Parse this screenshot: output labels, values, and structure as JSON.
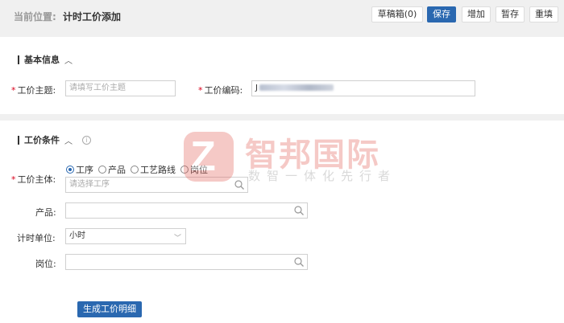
{
  "breadcrumb": {
    "label": "当前位置:",
    "current": "计时工价添加"
  },
  "toolbar": {
    "drafts": "草稿箱(0)",
    "save": "保存",
    "add": "增加",
    "temp_save": "暂存",
    "reset": "重填"
  },
  "basic": {
    "title": "基本信息",
    "topic_label": "工价主题:",
    "topic_placeholder": "请填写工价主题",
    "code_label": "工价编码:",
    "code_prefix": "J"
  },
  "conditions": {
    "title": "工价条件",
    "subject_label": "工价主体:",
    "radio_options": [
      "工序",
      "产品",
      "工艺路线",
      "岗位"
    ],
    "selected_radio": "工序",
    "process_placeholder": "请选择工序",
    "product_label": "产品:",
    "unit_label": "计时单位:",
    "unit_value": "小时",
    "position_label": "岗位:",
    "generate_button": "生成工价明细"
  },
  "watermark": {
    "logo_letter": "Z",
    "name": "智邦国际",
    "slogan": "数智一体化先行者"
  },
  "colors": {
    "primary": "#2a68b0",
    "required": "#d9001b",
    "watermark": "#e35a52"
  }
}
